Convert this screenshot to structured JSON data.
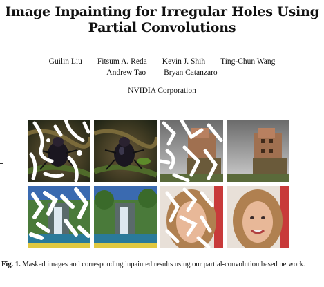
{
  "paper": {
    "title_line1": "Image Inpainting for Irregular Holes Using",
    "title_line2": "Partial Convolutions",
    "authors_row1": [
      "Guilin Liu",
      "Fitsum A. Reda",
      "Kevin J. Shih",
      "Ting-Chun Wang"
    ],
    "authors_row2": [
      "Andrew Tao",
      "Bryan Catanzaro"
    ],
    "affiliation": "NVIDIA Corporation"
  },
  "figure": {
    "caption_label": "Fig. 1.",
    "caption_text": "Masked images and corresponding inpainted results using our partial-convolution based network.",
    "panels": [
      {
        "row": 0,
        "col": 0,
        "subject": "beetle",
        "masked": true
      },
      {
        "row": 0,
        "col": 1,
        "subject": "beetle",
        "masked": false
      },
      {
        "row": 0,
        "col": 2,
        "subject": "cliff-houses",
        "masked": true
      },
      {
        "row": 0,
        "col": 3,
        "subject": "cliff-houses",
        "masked": false
      },
      {
        "row": 1,
        "col": 0,
        "subject": "waterfall",
        "masked": true
      },
      {
        "row": 1,
        "col": 1,
        "subject": "waterfall",
        "masked": false
      },
      {
        "row": 1,
        "col": 2,
        "subject": "portrait",
        "masked": true
      },
      {
        "row": 1,
        "col": 3,
        "subject": "portrait",
        "masked": false
      }
    ]
  }
}
